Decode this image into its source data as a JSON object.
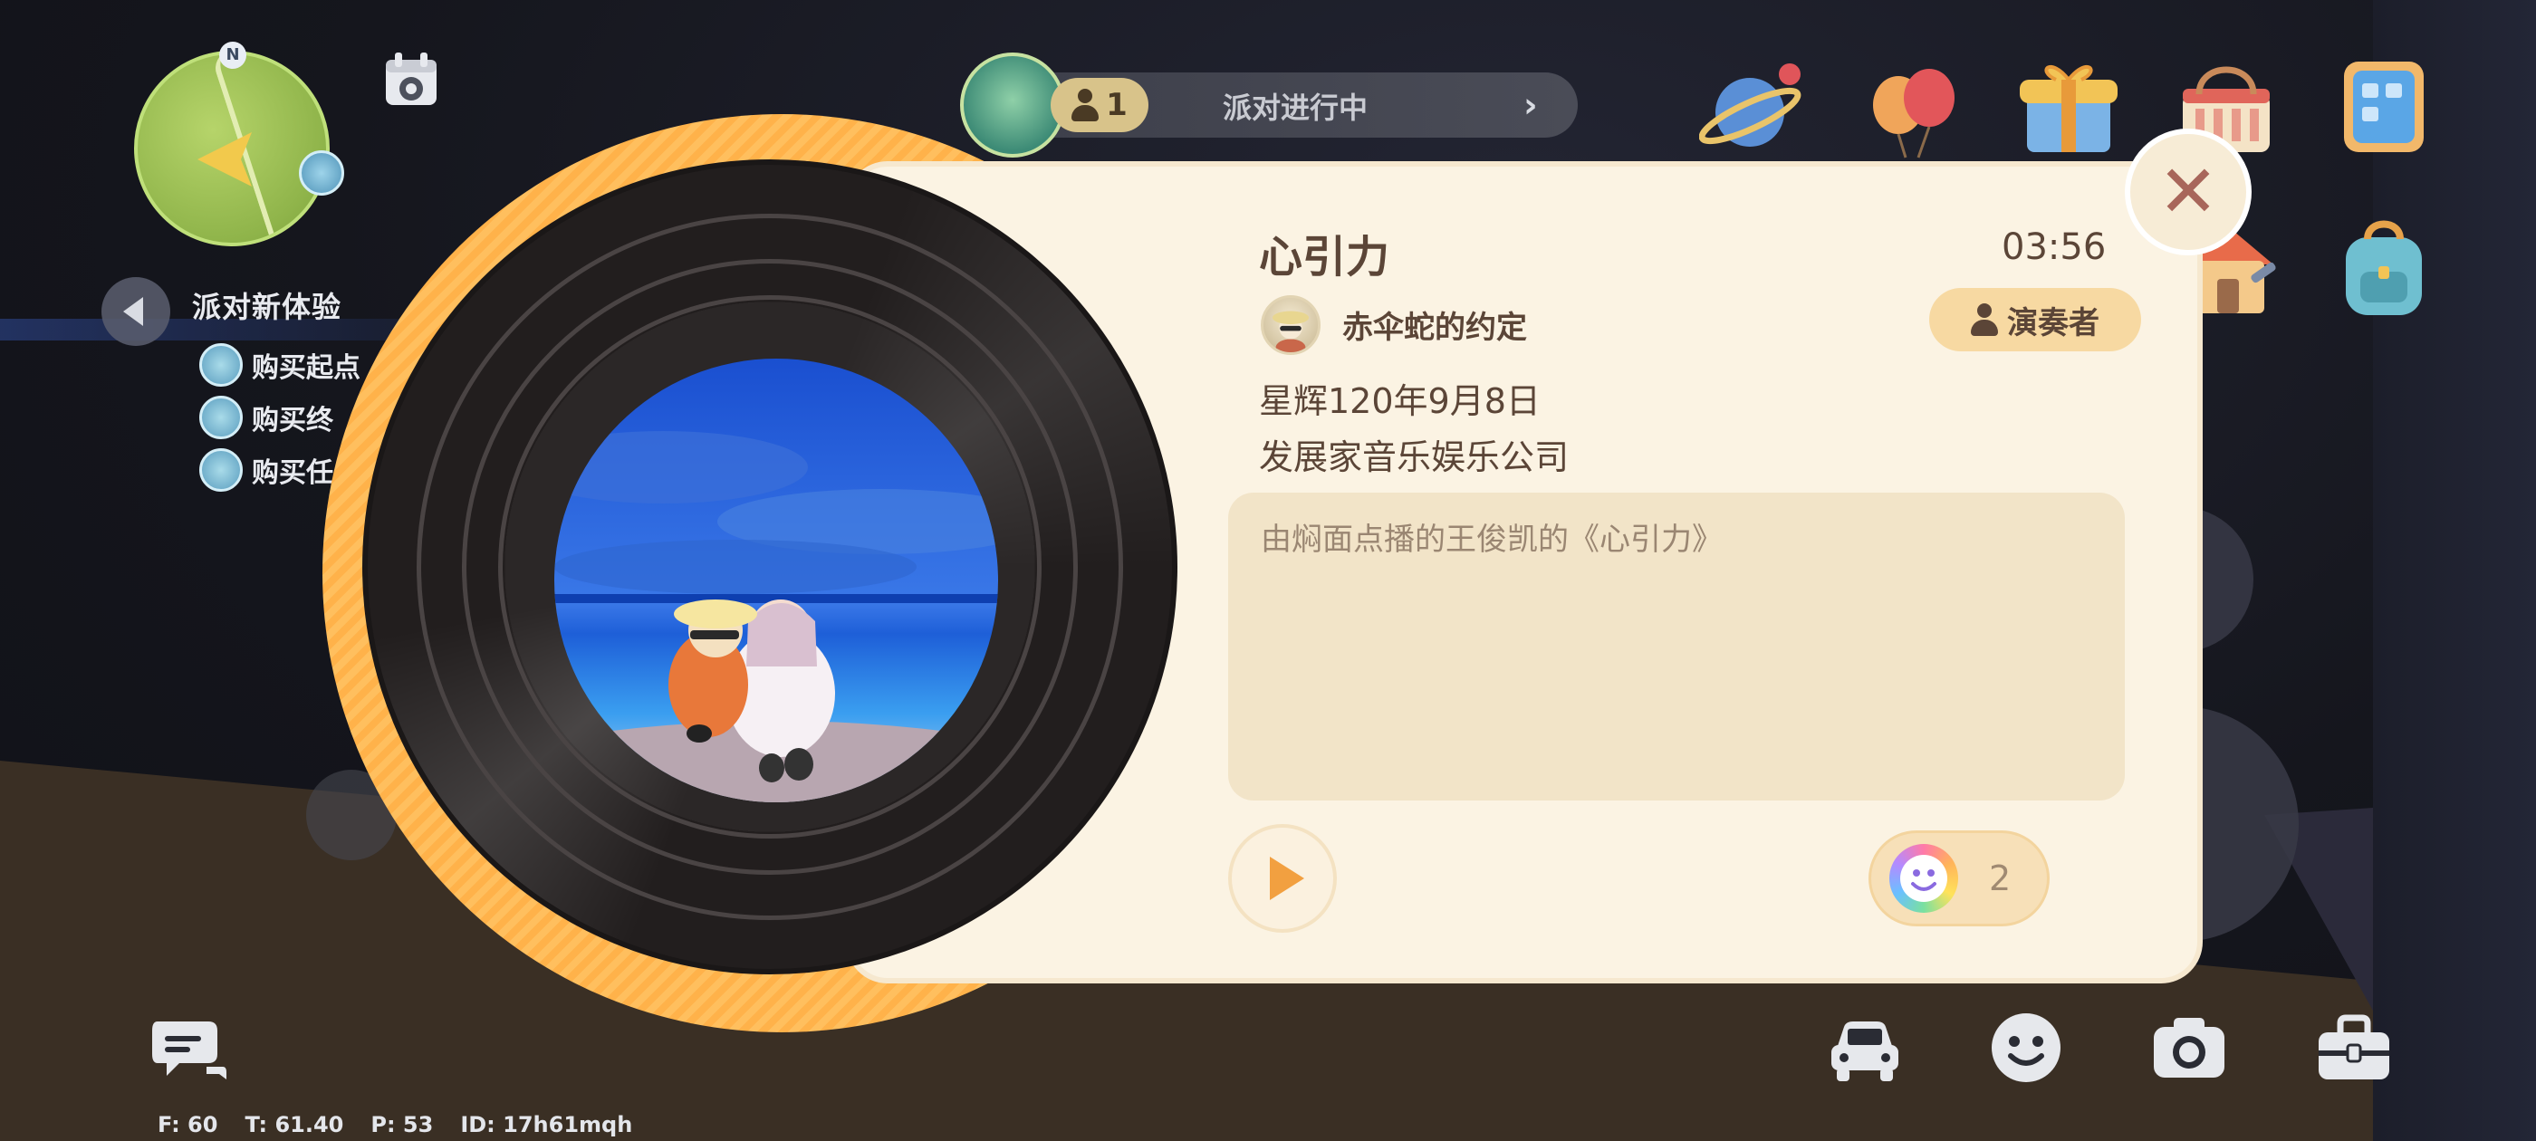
{
  "party": {
    "member_count": "1",
    "status_label": "派对进行中"
  },
  "minimap": {
    "north_label": "N"
  },
  "quests": {
    "title": "派对新体验",
    "items": [
      {
        "label": "购买起点"
      },
      {
        "label": "购买终"
      },
      {
        "label": "购买任"
      }
    ]
  },
  "song": {
    "title": "心引力",
    "duration": "03:56",
    "uploader": "赤伞蛇的约定",
    "performer_label": "演奏者",
    "release_date": "星辉120年9月8日",
    "publisher": "发展家音乐娱乐公司",
    "message": "由焖面点播的王俊凯的《心引力》",
    "like_count": "2"
  },
  "close_label": "✕",
  "stats": {
    "fps": "F: 60",
    "time": "T: 61.40",
    "ping": "P: 53",
    "id": "ID: 17h61mqh"
  },
  "icons": {
    "top_right": [
      "planet-icon",
      "balloons-icon",
      "gift-house-icon",
      "shop-basket-icon",
      "tablet-icon",
      "build-house-icon",
      "backpack-icon"
    ],
    "bottom": [
      "chat-icon",
      "car-icon",
      "emote-icon",
      "camera-icon",
      "toolbox-icon"
    ]
  },
  "colors": {
    "card_background": "#fbf3e3",
    "vinyl_ring": "#ffb24a",
    "text_brown": "#5b4537",
    "accent_orange": "#f2a040"
  }
}
